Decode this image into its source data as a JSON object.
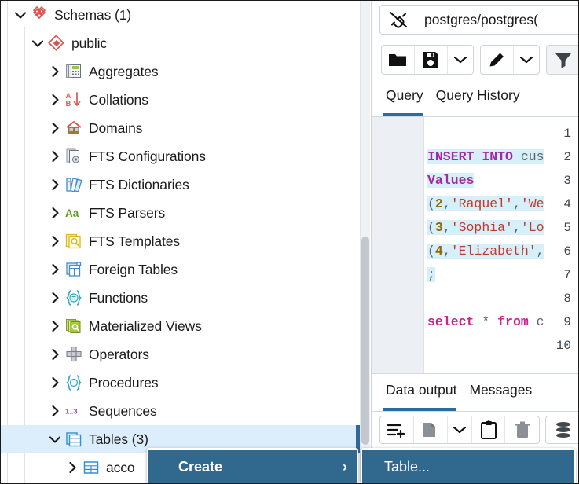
{
  "tree": {
    "rows": [
      {
        "label": "Schemas (1)",
        "icon": "schemas-icon",
        "state": "expanded",
        "depth": 0,
        "selected": false
      },
      {
        "label": "public",
        "icon": "schema-public-icon",
        "state": "expanded",
        "depth": 1,
        "selected": false
      },
      {
        "label": "Aggregates",
        "icon": "aggregates-icon",
        "state": "collapsed",
        "depth": 2,
        "selected": false
      },
      {
        "label": "Collations",
        "icon": "collations-icon",
        "state": "collapsed",
        "depth": 2,
        "selected": false
      },
      {
        "label": "Domains",
        "icon": "domains-icon",
        "state": "collapsed",
        "depth": 2,
        "selected": false
      },
      {
        "label": "FTS Configurations",
        "icon": "fts-configurations-icon",
        "state": "collapsed",
        "depth": 2,
        "selected": false
      },
      {
        "label": "FTS Dictionaries",
        "icon": "fts-dictionaries-icon",
        "state": "collapsed",
        "depth": 2,
        "selected": false
      },
      {
        "label": "FTS Parsers",
        "icon": "fts-parsers-icon",
        "state": "collapsed",
        "depth": 2,
        "selected": false
      },
      {
        "label": "FTS Templates",
        "icon": "fts-templates-icon",
        "state": "collapsed",
        "depth": 2,
        "selected": false
      },
      {
        "label": "Foreign Tables",
        "icon": "foreign-tables-icon",
        "state": "collapsed",
        "depth": 2,
        "selected": false
      },
      {
        "label": "Functions",
        "icon": "functions-icon",
        "state": "collapsed",
        "depth": 2,
        "selected": false
      },
      {
        "label": "Materialized Views",
        "icon": "materialized-views-icon",
        "state": "collapsed",
        "depth": 2,
        "selected": false
      },
      {
        "label": "Operators",
        "icon": "operators-icon",
        "state": "collapsed",
        "depth": 2,
        "selected": false
      },
      {
        "label": "Procedures",
        "icon": "procedures-icon",
        "state": "collapsed",
        "depth": 2,
        "selected": false
      },
      {
        "label": "Sequences",
        "icon": "sequences-icon",
        "state": "collapsed",
        "depth": 2,
        "selected": false
      },
      {
        "label": "Tables (3)",
        "icon": "tables-icon",
        "state": "expanded",
        "depth": 2,
        "selected": true
      },
      {
        "label": "acco",
        "icon": "table-icon",
        "state": "collapsed",
        "depth": 3,
        "selected": false
      }
    ]
  },
  "query_tool": {
    "connection": {
      "icon": "disconnected-plug-icon",
      "value": "postgres/postgres("
    },
    "toolbar": {
      "open_file": "open-file-icon",
      "save_file": "save-file-icon",
      "save_dropdown": "chevron-down-icon",
      "edit": "pencil-icon",
      "edit_dropdown": "chevron-down-icon",
      "filter": "filter-icon"
    },
    "tabs": [
      {
        "label": "Query",
        "active": true
      },
      {
        "label": "Query History",
        "active": false
      }
    ],
    "editor": {
      "line_numbers": [
        "1",
        "2",
        "3",
        "4",
        "5",
        "6",
        "7",
        "8",
        "9",
        "10"
      ],
      "lines": [
        {
          "n": "1",
          "text": "",
          "highlighted": false
        },
        {
          "n": "2",
          "text": "INSERT INTO cus",
          "highlighted": true
        },
        {
          "n": "3",
          "text": "Values",
          "highlighted": true
        },
        {
          "n": "4",
          "text": "(2,'Raquel','We",
          "highlighted": true
        },
        {
          "n": "5",
          "text": "(3,'Sophia','Lo",
          "highlighted": true
        },
        {
          "n": "6",
          "text": "(4,'Elizabeth',",
          "highlighted": true
        },
        {
          "n": "7",
          "text": ";",
          "highlighted": true
        },
        {
          "n": "8",
          "text": "",
          "highlighted": false
        },
        {
          "n": "9",
          "text": "select * from c",
          "highlighted": false
        },
        {
          "n": "10",
          "text": "",
          "highlighted": false
        }
      ]
    },
    "output": {
      "tabs": [
        {
          "label": "Data output",
          "active": true
        },
        {
          "label": "Messages",
          "active": false
        }
      ],
      "toolbar": {
        "add_row": "add-row-icon",
        "copy": "copy-icon",
        "copy_dropdown": "chevron-down-icon",
        "paste": "paste-icon",
        "delete": "trash-icon",
        "save_data": "save-data-icon"
      }
    }
  },
  "context_menu": {
    "create": {
      "label": "Create",
      "submenu_arrow": "chevron-right-icon"
    },
    "submenu": {
      "label": "Table..."
    }
  },
  "colors": {
    "menu_highlight": "#31688e",
    "tree_selection": "#dcedfb",
    "tab_underline": "#2d6d9e",
    "code_highlight": "#d6f0fa"
  }
}
